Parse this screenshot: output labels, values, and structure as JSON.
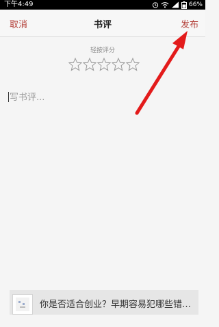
{
  "status_bar": {
    "time": "下午4:49",
    "battery_percent": "66%",
    "icons": [
      "alarm-icon",
      "wifi-icon",
      "signal-icon",
      "battery-icon"
    ]
  },
  "nav": {
    "cancel_label": "取消",
    "title": "书评",
    "publish_label": "发布"
  },
  "rating": {
    "label": "轻按评分",
    "max_stars": 5,
    "selected_stars": 0
  },
  "review": {
    "placeholder": "写书评..."
  },
  "ad": {
    "text": "你是否适合创业？早期容易犯哪些错…"
  },
  "colors": {
    "accent": "#b5443d",
    "annotation_arrow": "#e31b1b",
    "background": "#f5f5f5"
  }
}
